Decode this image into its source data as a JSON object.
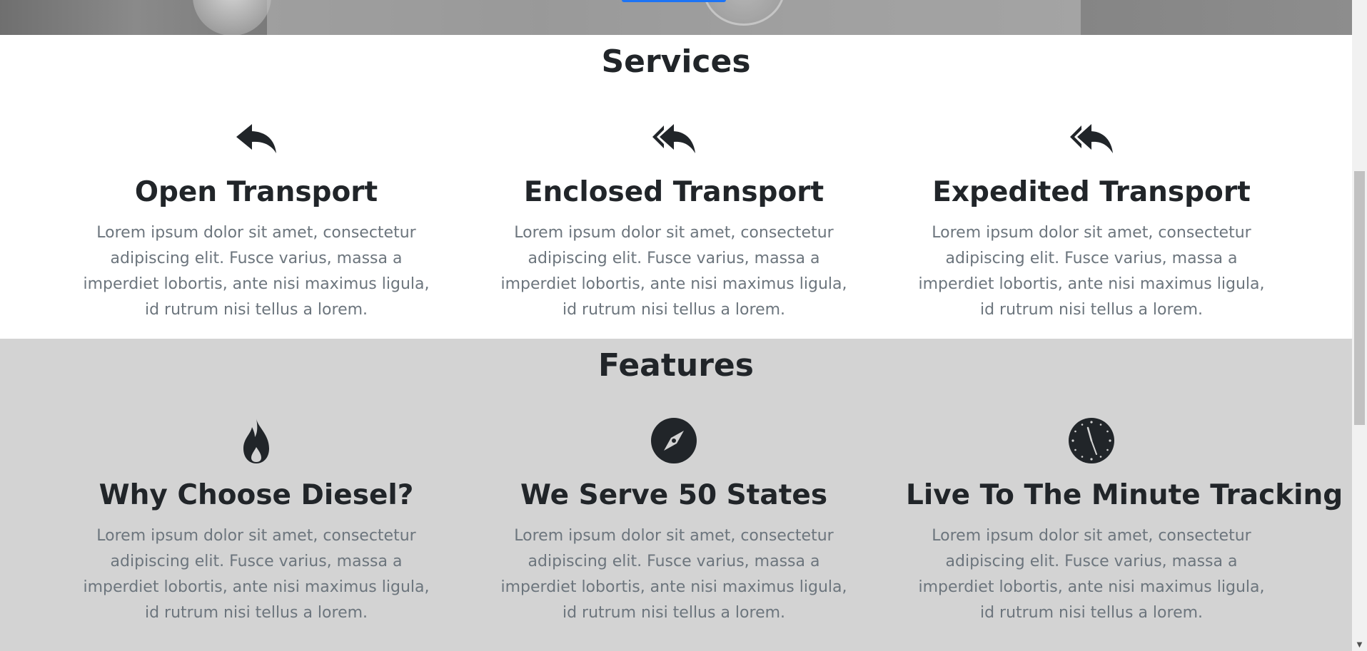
{
  "hero": {
    "cta_color": "#1d74f5"
  },
  "services": {
    "title": "Services",
    "items": [
      {
        "icon": "reply-icon",
        "heading": "Open Transport",
        "text": "Lorem ipsum dolor sit amet, consectetur adipiscing elit. Fusce varius, massa a imperdiet lobortis, ante nisi maximus ligula, id rutrum nisi tellus a lorem."
      },
      {
        "icon": "reply-all-icon",
        "heading": "Enclosed Transport",
        "text": "Lorem ipsum dolor sit amet, consectetur adipiscing elit. Fusce varius, massa a imperdiet lobortis, ante nisi maximus ligula, id rutrum nisi tellus a lorem."
      },
      {
        "icon": "reply-all-icon",
        "heading": "Expedited Transport",
        "text": "Lorem ipsum dolor sit amet, consectetur adipiscing elit. Fusce varius, massa a imperdiet lobortis, ante nisi maximus ligula, id rutrum nisi tellus a lorem."
      }
    ]
  },
  "features": {
    "title": "Features",
    "items": [
      {
        "icon": "fire-icon",
        "heading": "Why Choose Diesel?",
        "text": "Lorem ipsum dolor sit amet, consectetur adipiscing elit. Fusce varius, massa a imperdiet lobortis, ante nisi maximus ligula, id rutrum nisi tellus a lorem."
      },
      {
        "icon": "compass-icon",
        "heading": "We Serve 50 States",
        "text": "Lorem ipsum dolor sit amet, consectetur adipiscing elit. Fusce varius, massa a imperdiet lobortis, ante nisi maximus ligula, id rutrum nisi tellus a lorem."
      },
      {
        "icon": "clock-icon",
        "heading": "Live To The Minute Tracking",
        "text": "Lorem ipsum dolor sit amet, consectetur adipiscing elit. Fusce varius, massa a imperdiet lobortis, ante nisi maximus ligula, id rutrum nisi tellus a lorem."
      }
    ]
  },
  "colors": {
    "features_bg": "#d3d3d3",
    "heading": "#212529",
    "body_text": "#6c757d"
  }
}
